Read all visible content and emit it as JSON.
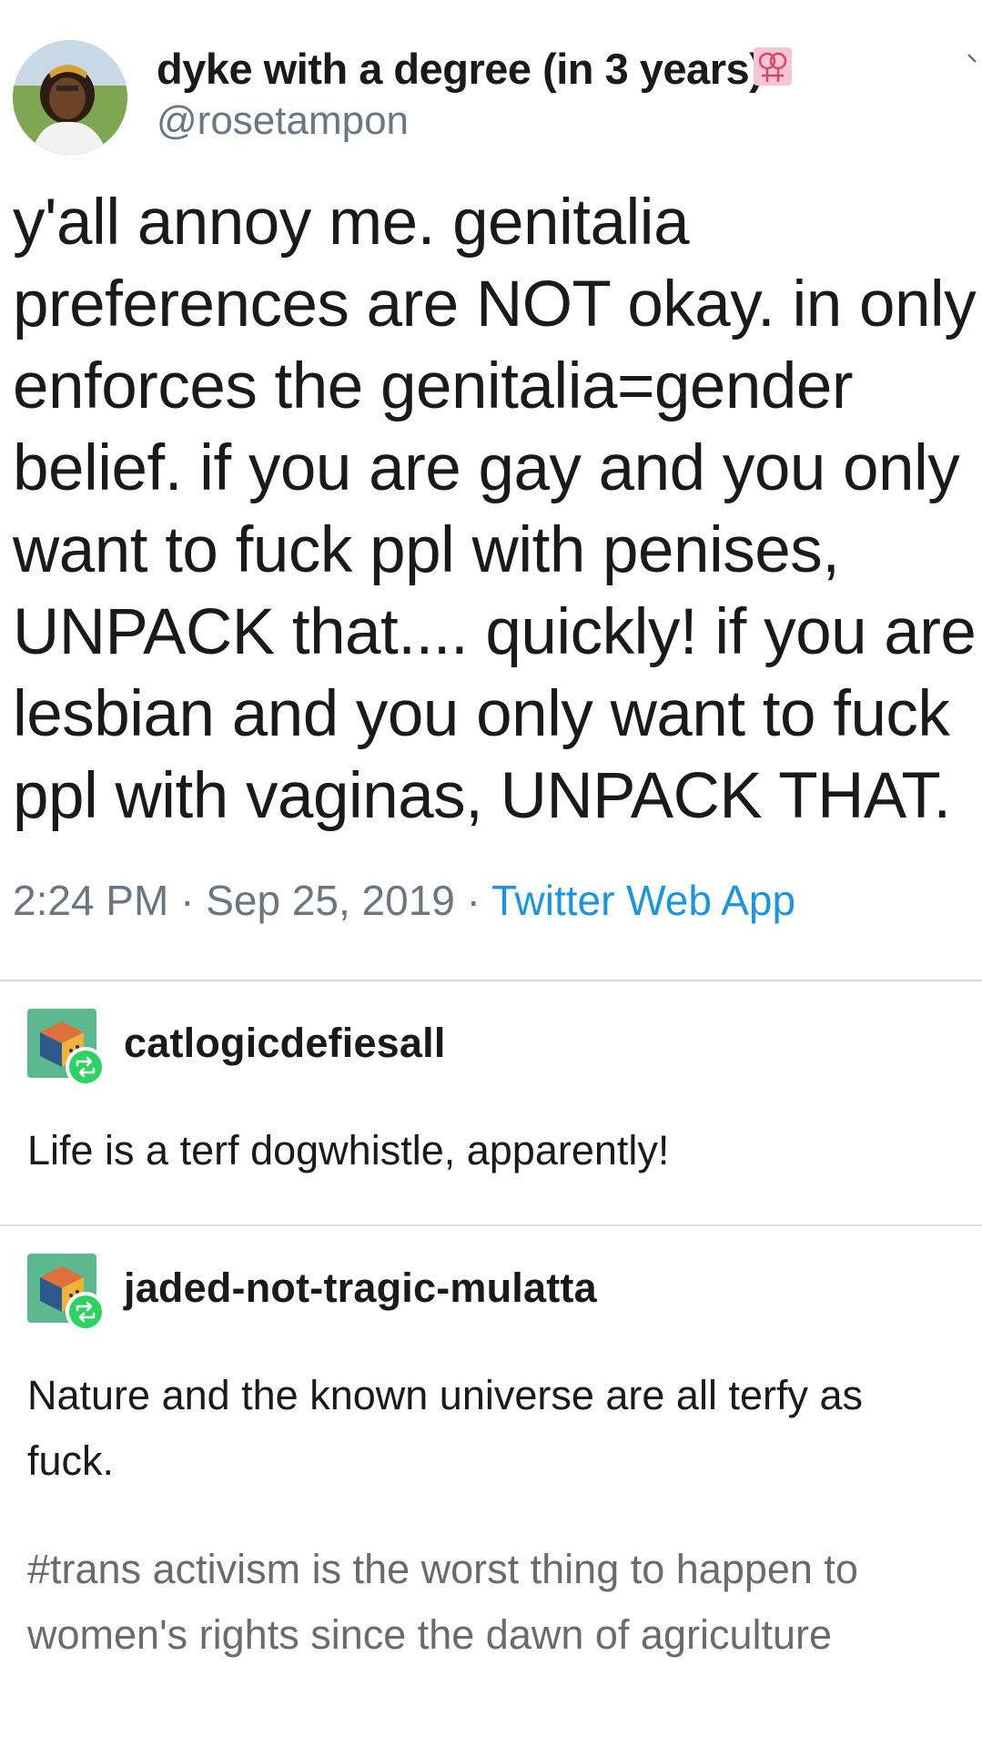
{
  "tweet": {
    "display_name": "dyke with a degree (in 3 years)",
    "handle": "@rosetampon",
    "text": "y'all annoy me. genitalia preferences are NOT okay. in only enforces the genitalia=gender belief. if you are gay and you only want to fuck ppl with penises, UNPACK that.... quickly! if you are lesbian and you only want to fuck ppl with vaginas, UNPACK THAT.",
    "time": "2:24 PM",
    "sep1": " · ",
    "date": "Sep 25, 2019",
    "sep2": " · ",
    "source": "Twitter Web App",
    "icons": {
      "avatar": "profile-photo",
      "name_emoji": "double-venus-icon",
      "menu": "chevron-down-icon"
    }
  },
  "reblogs": [
    {
      "username": "catlogicdefiesall",
      "text": "Life is a terf dogwhistle, apparently!",
      "avatar_icon": "cube-avatar-icon",
      "badge_icon": "reblog-icon"
    },
    {
      "username": "jaded-not-tragic-mulatta",
      "text": "Nature and the known universe are all terfy as fuck.",
      "tags": "#trans activism is the worst thing to happen to women's rights since the dawn of agriculture",
      "avatar_icon": "cube-avatar-icon",
      "badge_icon": "reblog-icon"
    }
  ],
  "colors": {
    "text": "#1a1a1a",
    "muted": "#6b7680",
    "link": "#1b95e0",
    "reblog_green": "#2dd260",
    "avatar_green": "#5cb88f",
    "divider": "#dcdcdc",
    "tag_gray": "#6b6b6b"
  }
}
